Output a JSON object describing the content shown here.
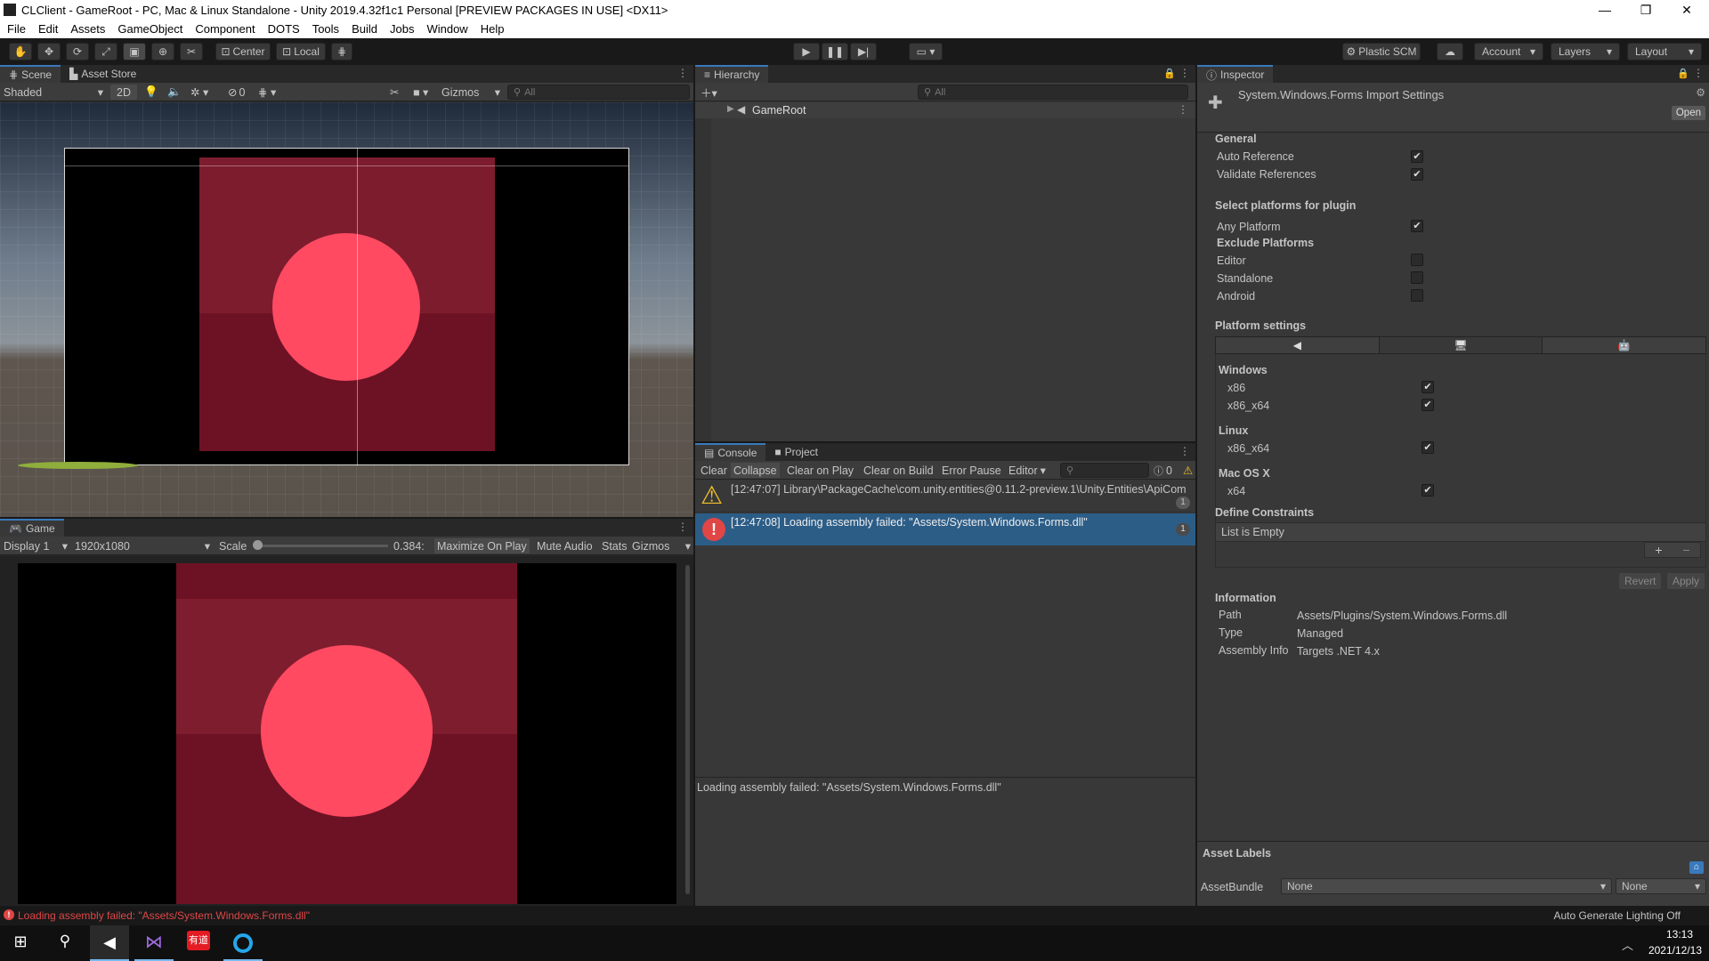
{
  "window": {
    "title": "CLClient - GameRoot - PC, Mac & Linux Standalone - Unity 2019.4.32f1c1 Personal [PREVIEW PACKAGES IN USE] <DX11>",
    "minimize": "—",
    "maximize": "❐",
    "close": "✕"
  },
  "menu": [
    "File",
    "Edit",
    "Assets",
    "GameObject",
    "Component",
    "DOTS",
    "Tools",
    "Build",
    "Jobs",
    "Window",
    "Help"
  ],
  "toolbar": {
    "tools": [
      "hand-tool",
      "move-tool",
      "rotate-tool",
      "scale-tool",
      "rect-tool",
      "transform-tool",
      "custom-tool"
    ],
    "pivot_center": "Center",
    "pivot_local": "Local",
    "plastic": "Plastic SCM",
    "account": "Account",
    "layers": "Layers",
    "layout": "Layout"
  },
  "scene": {
    "tabs": [
      "Scene",
      "Asset Store"
    ],
    "shading": "Shaded",
    "mode2d": "2D",
    "hidden_count": "0",
    "gizmos": "Gizmos",
    "search_placeholder": "All"
  },
  "game": {
    "tab": "Game",
    "display": "Display 1",
    "resolution": "1920x1080",
    "scale_label": "Scale",
    "scale_value": "0.384:",
    "scale_fraction": 0.02,
    "buttons": [
      "Maximize On Play",
      "Mute Audio",
      "Stats",
      "Gizmos"
    ]
  },
  "hierarchy": {
    "tab": "Hierarchy",
    "search_placeholder": "All",
    "root": "GameRoot"
  },
  "console": {
    "tabs": [
      "Console",
      "Project"
    ],
    "buttons": [
      "Clear",
      "Collapse",
      "Clear on Play",
      "Clear on Build",
      "Error Pause",
      "Editor"
    ],
    "error_count": "0",
    "entries": [
      {
        "type": "warning",
        "text": "[12:47:07] Library\\PackageCache\\com.unity.entities@0.11.2-preview.1\\Unity.Entities\\ApiCom",
        "count": "1"
      },
      {
        "type": "error",
        "text": "[12:47:08] Loading assembly failed: \"Assets/System.Windows.Forms.dll\"",
        "count": "1"
      }
    ],
    "detail": "Loading assembly failed: \"Assets/System.Windows.Forms.dll\""
  },
  "inspector": {
    "tab": "Inspector",
    "title": "System.Windows.Forms Import Settings",
    "open": "Open",
    "general": "General",
    "auto_reference": "Auto Reference",
    "validate_references": "Validate References",
    "select_platforms": "Select platforms for plugin",
    "any_platform": "Any Platform",
    "exclude_platforms": "Exclude Platforms",
    "excluded": [
      "Editor",
      "Standalone",
      "Android"
    ],
    "platform_settings": "Platform settings",
    "windows": "Windows",
    "win_x86": "x86",
    "win_x86_64": "x86_x64",
    "linux": "Linux",
    "linux_x86_64": "x86_x64",
    "macos": "Mac OS X",
    "mac_x64": "x64",
    "define_constraints": "Define Constraints",
    "list_empty": "List is Empty",
    "plus": "+",
    "minus": "−",
    "revert": "Revert",
    "apply": "Apply",
    "information": "Information",
    "info": [
      {
        "key": "Path",
        "value": "Assets/Plugins/System.Windows.Forms.dll"
      },
      {
        "key": "Type",
        "value": "Managed"
      },
      {
        "key": "Assembly Info",
        "value": "Targets .NET 4.x"
      }
    ],
    "asset_labels": "Asset Labels",
    "assetbundle": "AssetBundle",
    "bundle_none": "None",
    "variant_none": "None"
  },
  "statusbar": {
    "message": "Loading assembly failed: \"Assets/System.Windows.Forms.dll\"",
    "lighting": "Auto Generate Lighting Off"
  },
  "taskbar": {
    "time": "13:13",
    "date": "2021/12/13",
    "app3": "有道"
  },
  "colors": {
    "accent": "#3a79bb",
    "error": "#e04646",
    "warning": "#f2c228",
    "sprite_dark": "#6d1224",
    "circle": "#ff4a62"
  }
}
